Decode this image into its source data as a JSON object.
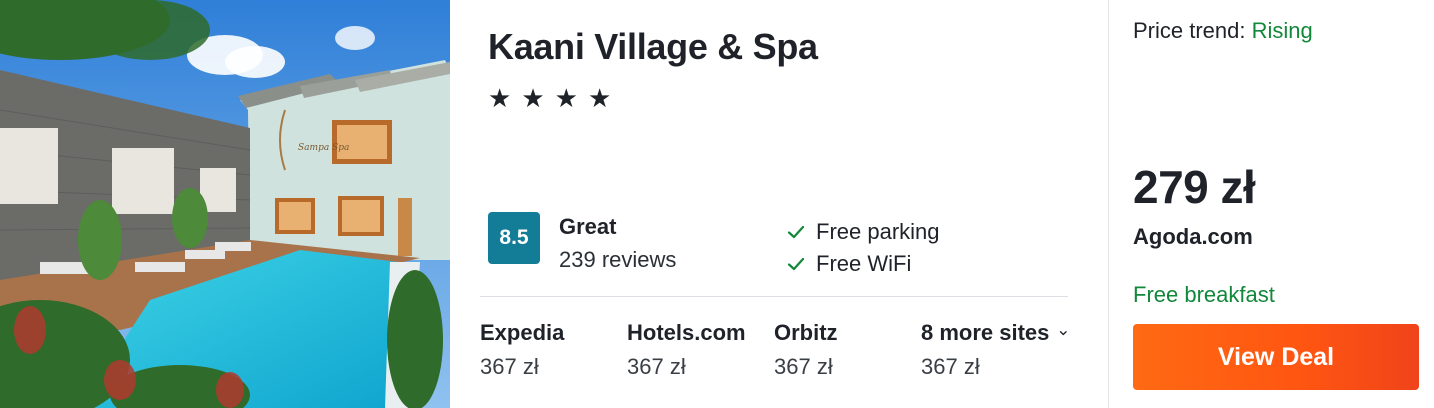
{
  "hotel": {
    "name": "Kaani Village & Spa",
    "stars": [
      "★",
      "★",
      "★",
      "★"
    ],
    "star_count": 4,
    "image_sign": "Sampa Spa"
  },
  "rating": {
    "score": "8.5",
    "label": "Great",
    "reviews": "239 reviews",
    "badge_color": "#137c97"
  },
  "amenities": [
    {
      "label": "Free parking",
      "icon": "checkmark-icon"
    },
    {
      "label": "Free WiFi",
      "icon": "checkmark-icon"
    }
  ],
  "sites": [
    {
      "name": "Expedia",
      "price": "367 zł"
    },
    {
      "name": "Hotels.com",
      "price": "367 zł"
    },
    {
      "name": "Orbitz",
      "price": "367 zł"
    },
    {
      "name": "8 more sites",
      "price": "367 zł",
      "icon": "chevron-down-icon"
    }
  ],
  "deal": {
    "trend_label": "Price trend:",
    "trend_value": "Rising",
    "price": "279 zł",
    "provider": "Agoda.com",
    "perk": "Free breakfast",
    "button_label": "View Deal"
  },
  "colors": {
    "accent_green": "#12883a",
    "button_orange": "#ff5a12",
    "text_dark": "#1f2329"
  }
}
